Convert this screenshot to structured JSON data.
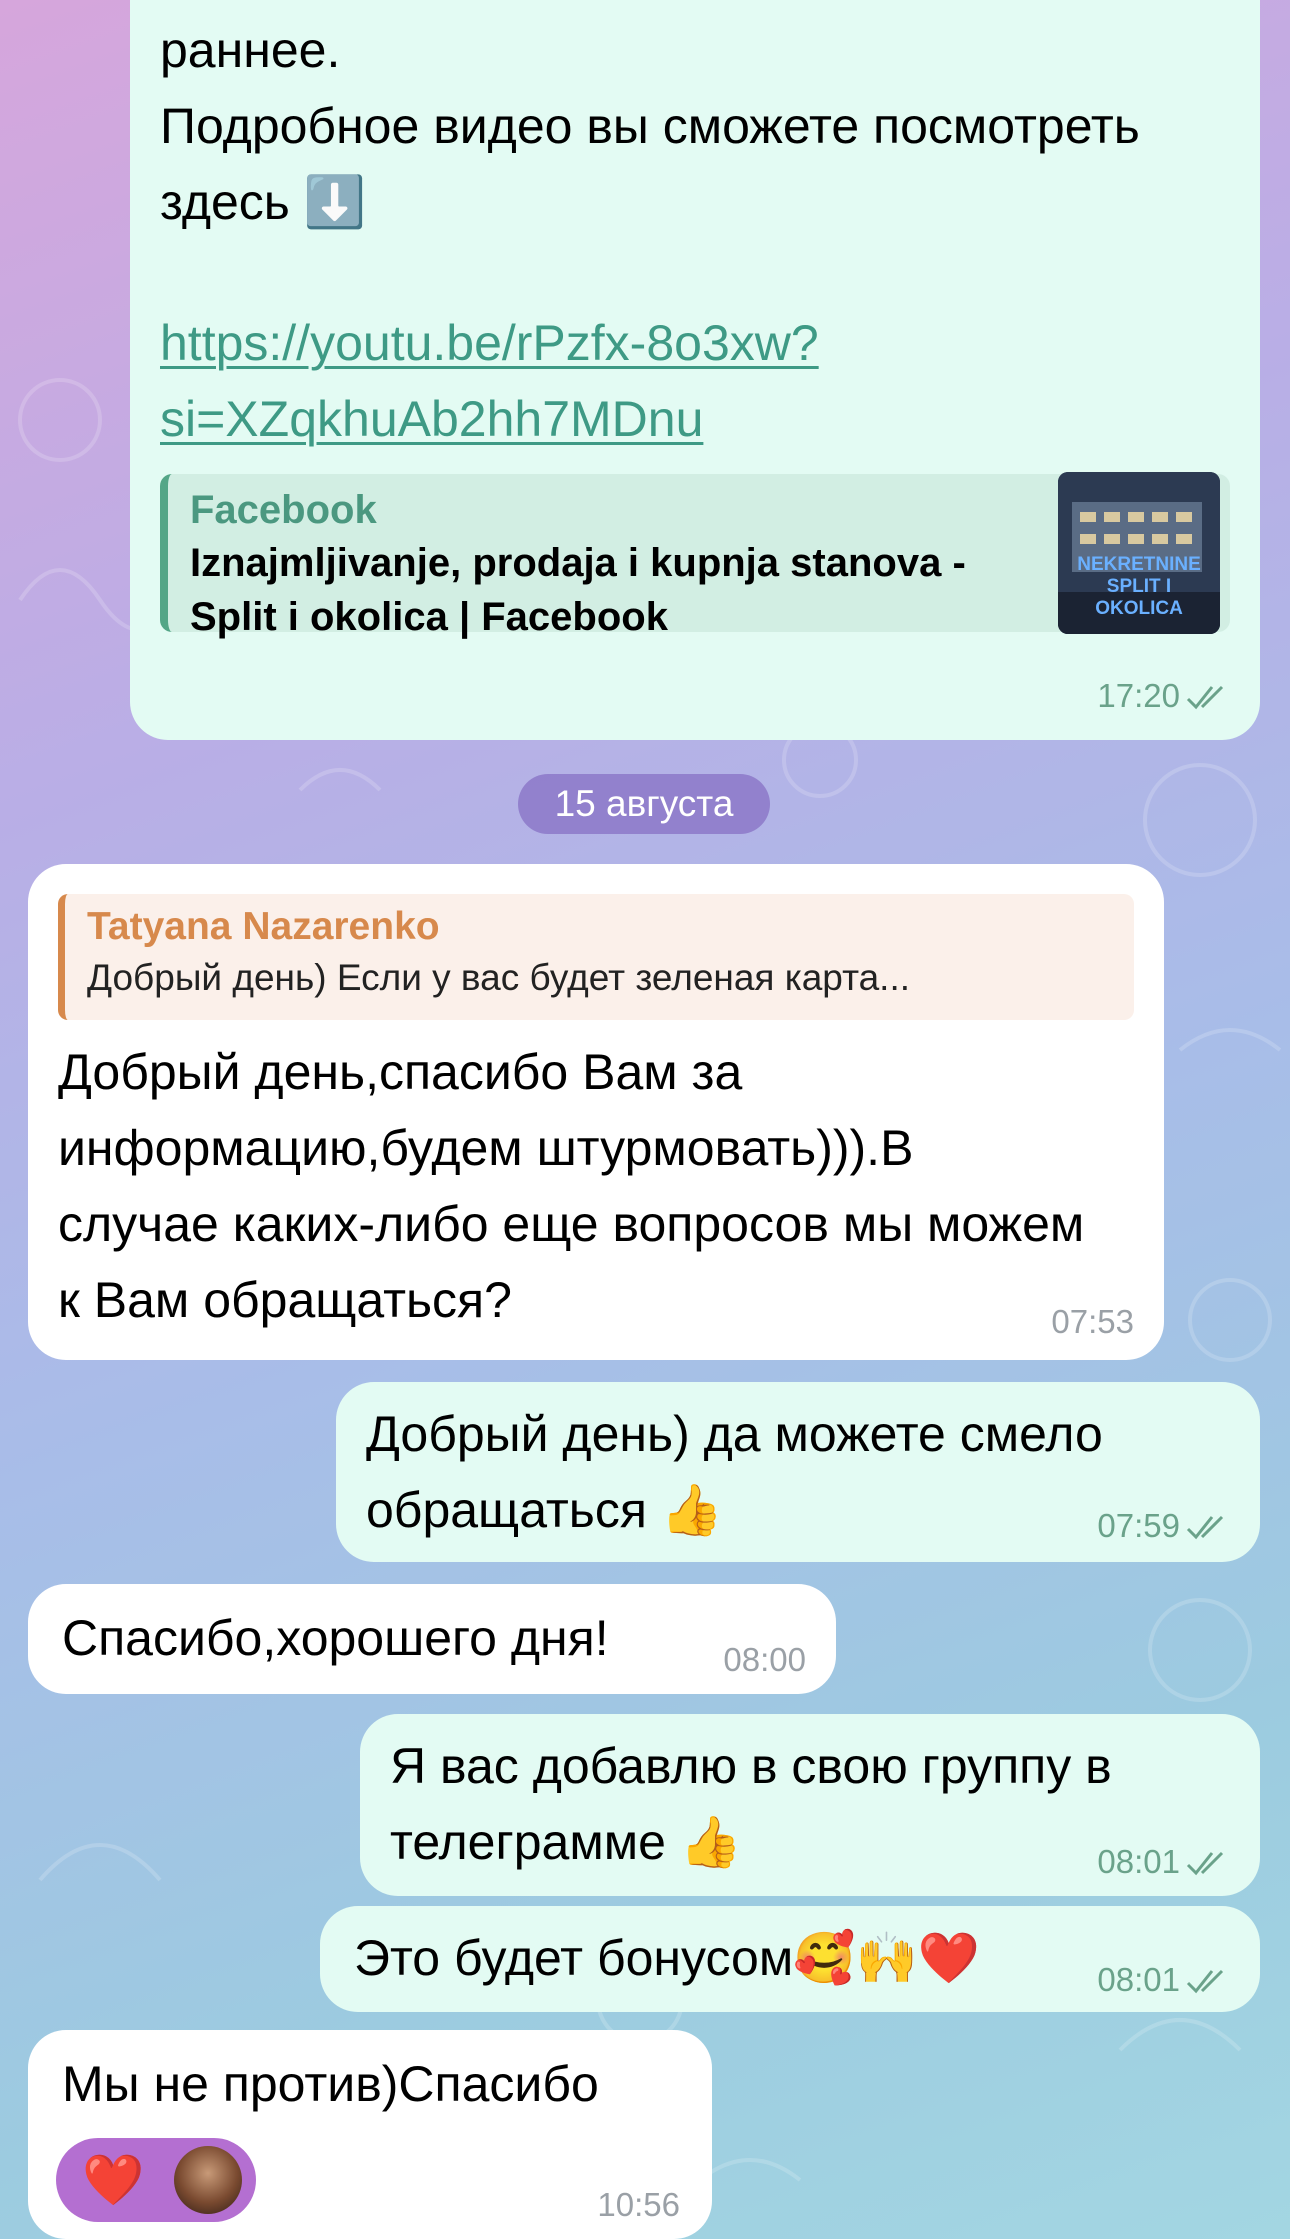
{
  "messages": {
    "m1": {
      "text": "раннее.\nПодробное видео вы сможете посмотреть здесь ⬇️",
      "link_line1": "https://youtu.be/rPzfx-8o3xw?",
      "link_line2": "si=XZqkhuAb2hh7MDnu",
      "preview_site": "Facebook",
      "preview_title": "Iznajmljivanje, prodaja i kupnja stanova - Split i okolica | Facebook",
      "thumb_text": "NEKRETNINE SPLIT I OKOLICA",
      "time": "17:20"
    },
    "date_separator": "15 августа",
    "m2": {
      "reply_name": "Tatyana Nazarenko",
      "reply_text": "Добрый день) Если у вас будет зеленая карта...",
      "text": "Добрый день,спасибо Вам за информацию,будем штурмовать))).В случае каких-либо еще вопросов мы можем к Вам обращаться?",
      "time": "07:53"
    },
    "m3": {
      "text": "Добрый день) да можете смело обращаться 👍",
      "time": "07:59"
    },
    "m4": {
      "text": "Спасибо,хорошего дня!",
      "time": "08:00"
    },
    "m5": {
      "text": "Я вас добавлю в свою группу в телеграмме 👍",
      "time": "08:01"
    },
    "m6": {
      "text": "Это будет бонусом🥰🙌❤️",
      "time": "08:01"
    },
    "m7": {
      "text": "Мы не против)Спасибо",
      "reaction": "❤️",
      "time": "10:56"
    }
  },
  "colors": {
    "outgoing_bubble": "#e3fbf3",
    "incoming_bubble": "#ffffff",
    "link": "#3e9a85",
    "reply_accent": "#d7894c",
    "reaction_pill": "#b46fd1",
    "date_pill": "#8c78c8"
  },
  "icons": [
    "double-check-icon",
    "arrow-down-emoji",
    "thumbs-up-emoji",
    "heart-emoji",
    "avatar"
  ]
}
